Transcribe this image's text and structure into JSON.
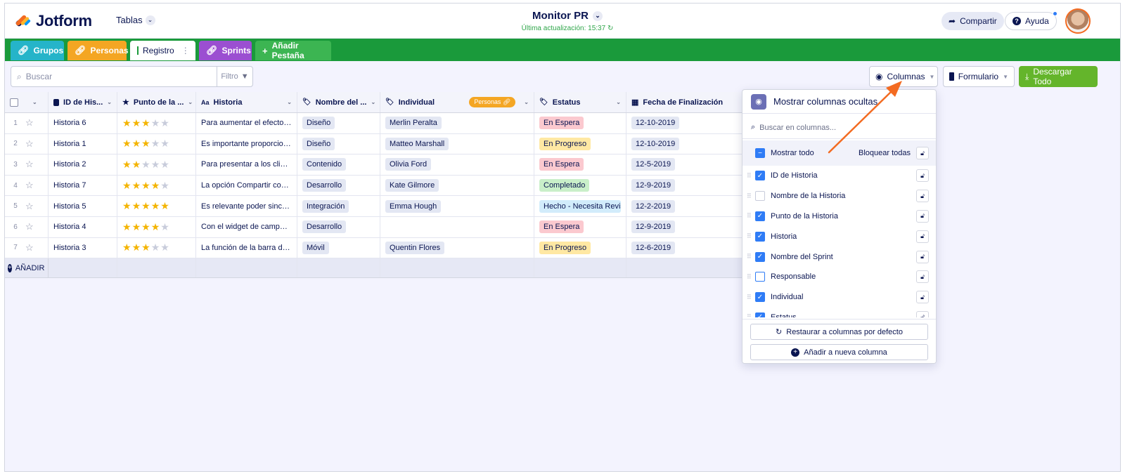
{
  "app": {
    "brand": "Jotform",
    "tables_label": "Tablas",
    "title": "Monitor PR",
    "last_update": "Última actualización: 15:37",
    "share_label": "Compartir",
    "help_label": "Ayuda"
  },
  "tabs": [
    {
      "label": "Grupos",
      "icon": "link-icon"
    },
    {
      "label": "Personas",
      "icon": "link-icon"
    },
    {
      "label": "Registro",
      "icon": "grid-icon",
      "active": true
    },
    {
      "label": "Sprints",
      "icon": "link-icon"
    },
    {
      "label": "Añadir Pestaña",
      "icon": "plus-icon"
    }
  ],
  "toolbar": {
    "search_placeholder": "Buscar",
    "filter_label": "Filtro",
    "columns_label": "Columnas",
    "form_label": "Formulario",
    "download_label": "Descargar Todo"
  },
  "table": {
    "headers": [
      "ID de His...",
      "Punto de la ...",
      "Historia",
      "Nombre del ...",
      "Individual",
      "Estatus",
      "Fecha de Finalización"
    ],
    "personas_badge": "Personas",
    "add_label": "AÑADIR",
    "rows": [
      {
        "num": "1",
        "id": "Historia 6",
        "stars": 3,
        "historia": "Para aumentar el efecto d...",
        "sprint": "Diseño",
        "individual": "Merlin Peralta",
        "estatus": "En Espera",
        "estatus_key": "espera",
        "fecha": "12-10-2019"
      },
      {
        "num": "2",
        "id": "Historia 1",
        "stars": 3,
        "historia": "Es importante proporcion...",
        "sprint": "Diseño",
        "individual": "Matteo Marshall",
        "estatus": "En Progreso",
        "estatus_key": "progreso",
        "fecha": "12-10-2019"
      },
      {
        "num": "3",
        "id": "Historia 2",
        "stars": 2,
        "historia": "Para presentar a los client...",
        "sprint": "Contenido",
        "individual": "Olivia Ford",
        "estatus": "En Espera",
        "estatus_key": "espera",
        "fecha": "12-5-2019"
      },
      {
        "num": "4",
        "id": "Historia 7",
        "stars": 4,
        "historia": "La opción Compartir com...",
        "sprint": "Desarrollo",
        "individual": "Kate Gilmore",
        "estatus": "Completado",
        "estatus_key": "completado",
        "fecha": "12-9-2019"
      },
      {
        "num": "5",
        "id": "Historia 5",
        "stars": 5,
        "historia": "Es relevante poder sincron...",
        "sprint": "Integración",
        "individual": "Emma Hough",
        "estatus": "Hecho - Necesita Revisió",
        "estatus_key": "hecho",
        "fecha": "12-2-2019"
      },
      {
        "num": "6",
        "id": "Historia 4",
        "stars": 4,
        "historia": "Con el widget de campo d...",
        "sprint": "Desarrollo",
        "individual": "",
        "estatus": "En Espera",
        "estatus_key": "espera",
        "fecha": "12-9-2019"
      },
      {
        "num": "7",
        "id": "Historia 3",
        "stars": 3,
        "historia": "La función de la barra de ...",
        "sprint": "Móvil",
        "individual": "Quentin Flores",
        "estatus": "En Progreso",
        "estatus_key": "progreso",
        "fecha": "12-6-2019"
      }
    ]
  },
  "columns_panel": {
    "title": "Mostrar columnas ocultas",
    "search_placeholder": "Buscar en columnas...",
    "show_all_label": "Mostrar todo",
    "lock_all_label": "Bloquear todas",
    "items": [
      {
        "label": "ID de Historia",
        "checked": true
      },
      {
        "label": "Nombre de la Historia",
        "checked": false
      },
      {
        "label": "Punto de la Historia",
        "checked": true
      },
      {
        "label": "Historia",
        "checked": true
      },
      {
        "label": "Nombre del Sprint",
        "checked": true
      },
      {
        "label": "Responsable",
        "checked": false,
        "focused": true
      },
      {
        "label": "Individual",
        "checked": true
      },
      {
        "label": "Estatus",
        "checked": true
      }
    ],
    "restore_label": "Restaurar a columnas por defecto",
    "add_column_label": "Añadir a nueva columna"
  },
  "colors": {
    "tabbar": "#1a9a3b",
    "accent_blue": "#2f7cf6",
    "download_green": "#64b52b",
    "annotation_arrow": "#f36b21"
  }
}
